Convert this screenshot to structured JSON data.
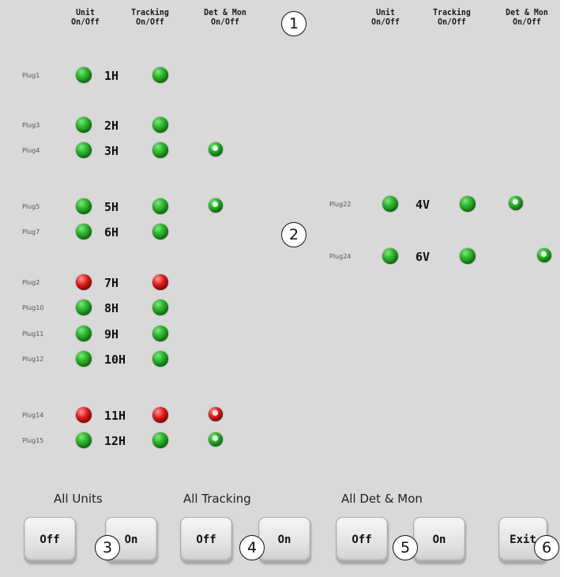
{
  "headers_left": {
    "unit": "Unit\nOn/Off",
    "tracking": "Tracking\nOn/Off",
    "det_mon": "Det & Mon\nOn/Off"
  },
  "headers_right": {
    "unit": "Unit\nOn/Off",
    "tracking": "Tracking\nOn/Off",
    "det_mon": "Det & Mon\nOn/Off"
  },
  "rows_left": [
    {
      "label": "Plug1",
      "code": "1H",
      "unit": "green",
      "tracking": "green",
      "det": ""
    },
    {
      "label": "Plug3",
      "code": "2H",
      "unit": "green",
      "tracking": "green",
      "det": ""
    },
    {
      "label": "Plug4",
      "code": "3H",
      "unit": "green",
      "tracking": "green",
      "det": "green"
    },
    {
      "label": "Plug5",
      "code": "5H",
      "unit": "green",
      "tracking": "green",
      "det": "green"
    },
    {
      "label": "Plug7",
      "code": "6H",
      "unit": "green",
      "tracking": "green",
      "det": ""
    },
    {
      "label": "Plug2",
      "code": "7H",
      "unit": "red",
      "tracking": "red",
      "det": ""
    },
    {
      "label": "Plug10",
      "code": "8H",
      "unit": "green",
      "tracking": "green",
      "det": ""
    },
    {
      "label": "Plug11",
      "code": "9H",
      "unit": "green",
      "tracking": "green",
      "det": ""
    },
    {
      "label": "Plug12",
      "code": "10H",
      "unit": "green",
      "tracking": "green",
      "det": ""
    },
    {
      "label": "Plug14",
      "code": "11H",
      "unit": "red",
      "tracking": "red",
      "det": "red"
    },
    {
      "label": "Plug15",
      "code": "12H",
      "unit": "green",
      "tracking": "green",
      "det": "green"
    }
  ],
  "rows_right": [
    {
      "label": "Plug22",
      "code": "4V",
      "unit": "green",
      "tracking": "green",
      "det": "green"
    },
    {
      "label": "Plug24",
      "code": "6V",
      "unit": "green",
      "tracking": "green",
      "det": "green"
    }
  ],
  "callouts": [
    "1",
    "2",
    "3",
    "4",
    "5",
    "6"
  ],
  "groups": {
    "units_label": "All Units",
    "tracking_label": "All Tracking",
    "detmon_label": "All Det & Mon"
  },
  "buttons": {
    "units_off": "Off",
    "units_on": "On",
    "tracking_off": "Off",
    "tracking_on": "On",
    "detmon_off": "Off",
    "detmon_on": "On",
    "exit": "Exit"
  },
  "colors": {
    "panel": "#d9d9d9",
    "led_on": "#2fb82f",
    "led_off": "#e41b1b"
  }
}
